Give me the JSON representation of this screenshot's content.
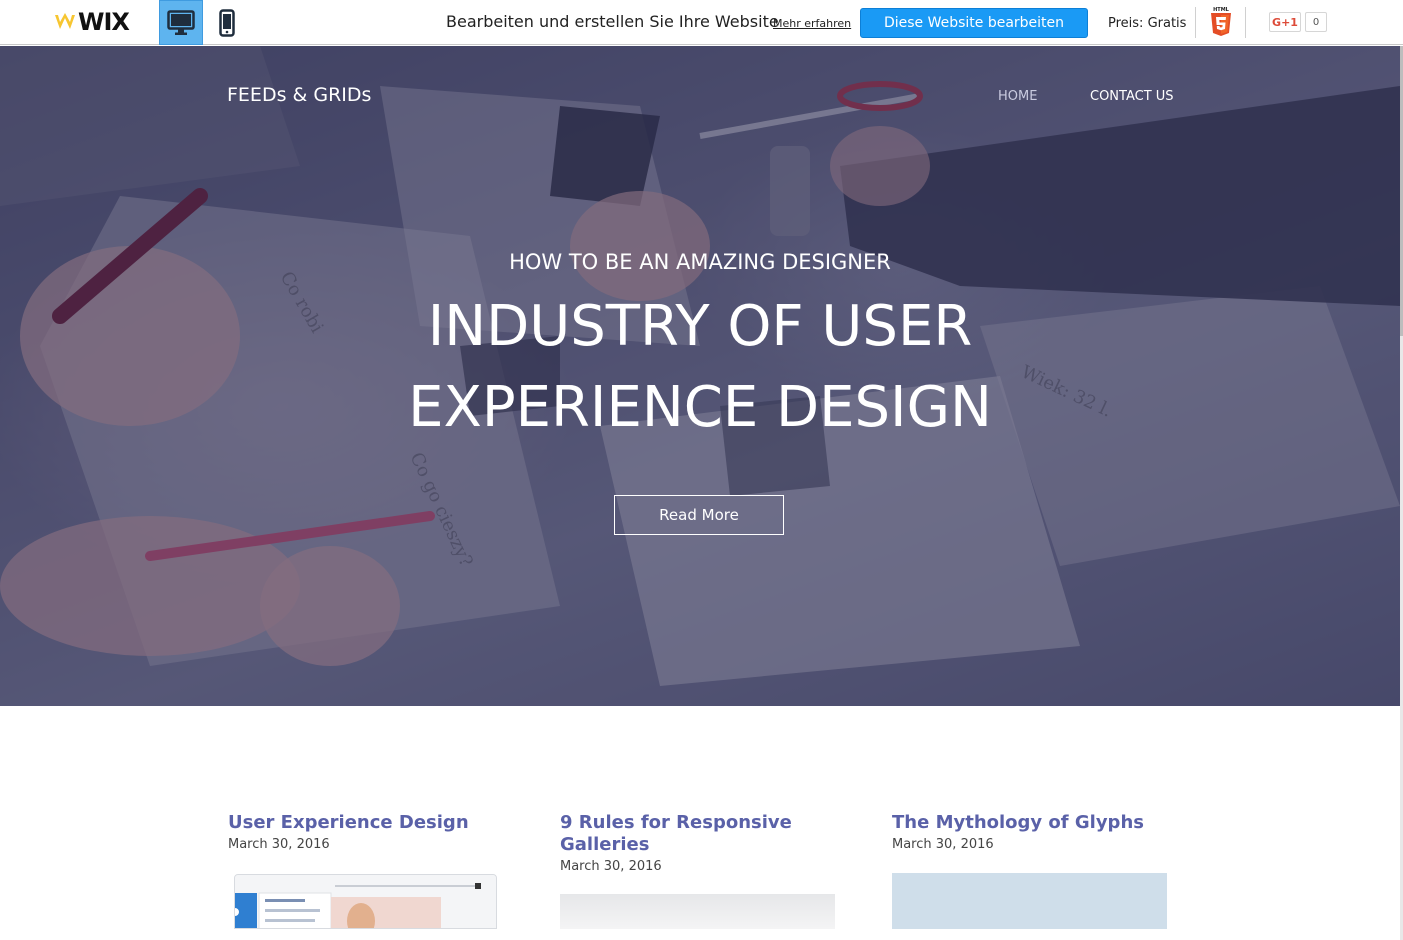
{
  "wix_bar": {
    "logo": "WIX",
    "promo_text": "Bearbeiten und erstellen Sie Ihre Website",
    "promo_link": "Mehr erfahren",
    "edit_button": "Diese Website bearbeiten",
    "price": "Preis: Gratis",
    "gplus_label": "G+1",
    "gplus_count": "0",
    "accent_color": "#1a9af5"
  },
  "site": {
    "title": "FEEDs & GRIDs",
    "nav": [
      "HOME",
      "CONTACT US"
    ]
  },
  "hero": {
    "kicker": "HOW TO BE AN AMAZING DESIGNER",
    "title_line1": "INDUSTRY OF USER",
    "title_line2": "EXPERIENCE DESIGN",
    "button": "Read More"
  },
  "posts": [
    {
      "title": "User Experience Design",
      "date": "March 30, 2016"
    },
    {
      "title": "9 Rules for Responsive Galleries",
      "date": "March 30, 2016"
    },
    {
      "title": "The Mythology of Glyphs",
      "date": "March 30, 2016"
    }
  ]
}
